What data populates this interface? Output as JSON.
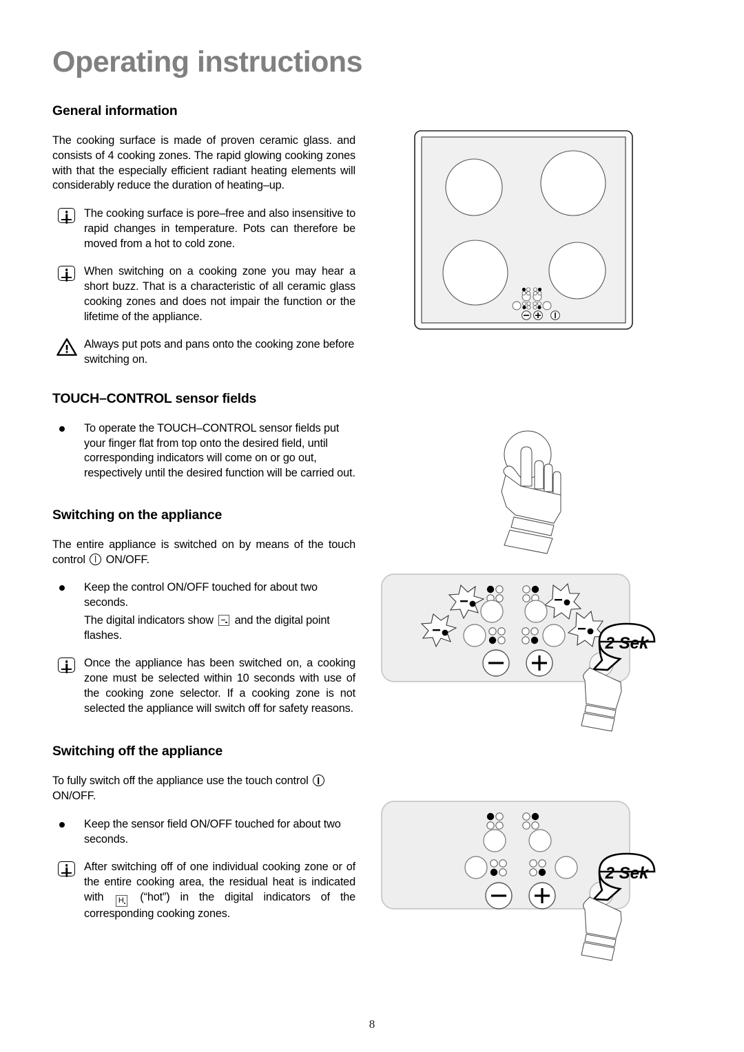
{
  "document": {
    "title": "Operating instructions",
    "page_number": "8"
  },
  "sections": {
    "general": {
      "heading": "General information",
      "intro": "The cooking surface is made of proven ceramic glass. and consists of 4 cooking zones. The rapid glowing cooking zones with that the especially efficient radiant heating elements will considerably reduce the duration of heating–up.",
      "note1": "The cooking surface is pore–free and also insensitive to rapid changes in temperature. Pots can therefore be moved from a hot to cold zone.",
      "note2": "When switching on a cooking zone you may hear a short buzz. That is a characteristic of all ceramic glass cooking zones and does not impair the function or the lifetime of the appliance.",
      "warning": "Always put pots and pans onto the cooking zone before switching on."
    },
    "touch_control": {
      "heading": "TOUCH–CONTROL sensor fields",
      "bullet1": "To operate the TOUCH–CONTROL sensor fields put your finger flat from top onto the desired field, until corresponding indicators will come on or go out, respectively until the desired function will be carried out."
    },
    "switching_on": {
      "heading": "Switching on the appliance",
      "intro_part1": "The entire appliance is switched on by means of the touch control",
      "intro_part2": "ON/OFF.",
      "bullet1": "Keep the control ON/OFF touched for about two seconds.",
      "bullet1_sub_part1": "The digital indicators show",
      "bullet1_sub_part2": "and the digital point flashes.",
      "note1": "Once the appliance has been switched on, a cooking zone must be selected within 10 seconds with use of the cooking zone selector. If a cooking zone is not selected the appliance will switch off for safety reasons."
    },
    "switching_off": {
      "heading": "Switching off the appliance",
      "intro_part1": "To fully switch off the appliance use the touch control",
      "intro_part2": "ON/OFF.",
      "bullet1": "Keep the sensor field ON/OFF touched for about two seconds.",
      "note1_part1": "After switching off of one individual cooking zone or of the entire cooking area, the residual heat is indicated with",
      "note1_part2": "(“hot”) in the digital indicators of the corresponding cooking zones.",
      "hot_glyph_letter": "H"
    }
  },
  "figures": {
    "hob": {
      "name": "ceramic-hob-top-view",
      "cooking_zones": 4,
      "control_icons": [
        "zone-selector",
        "zone-selector",
        "zone-selector",
        "zone-selector",
        "minus",
        "plus",
        "on-off"
      ]
    },
    "hand": {
      "name": "hand-pressing-sensor-field"
    },
    "panel_on": {
      "name": "control-panel-switching-on",
      "callout": "2 Sek",
      "minus_label": "−",
      "plus_label": "+",
      "flash_indicator": "-."
    },
    "panel_off": {
      "name": "control-panel-switching-off",
      "callout": "2 Sek",
      "minus_label": "−",
      "plus_label": "+"
    }
  },
  "colors": {
    "title_gray": "#808080",
    "panel_fill": "#eeeeee",
    "hob_fill": "#f0f0f0",
    "line": "#000000"
  }
}
